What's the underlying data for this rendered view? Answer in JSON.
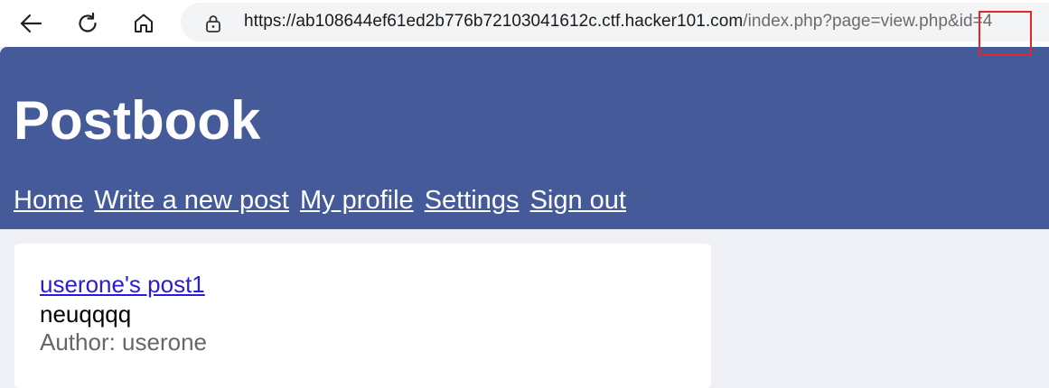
{
  "browser": {
    "url_host": "https://ab108644ef61ed2b776b72103041612c.ctf.hacker101.com",
    "url_path": "/index.php?page=view.php&id=4",
    "icons": [
      "back-arrow-icon",
      "reload-icon",
      "home-icon",
      "lock-icon"
    ],
    "highlight_color": "#e2262a"
  },
  "site": {
    "title": "Postbook",
    "header_color": "#455a99",
    "nav": [
      "Home",
      "Write a new post",
      "My profile",
      "Settings",
      "Sign out"
    ]
  },
  "post": {
    "title": "userone's post1",
    "body": "neuqqqq",
    "author": "Author: userone",
    "link_color": "#2b1bd8"
  }
}
